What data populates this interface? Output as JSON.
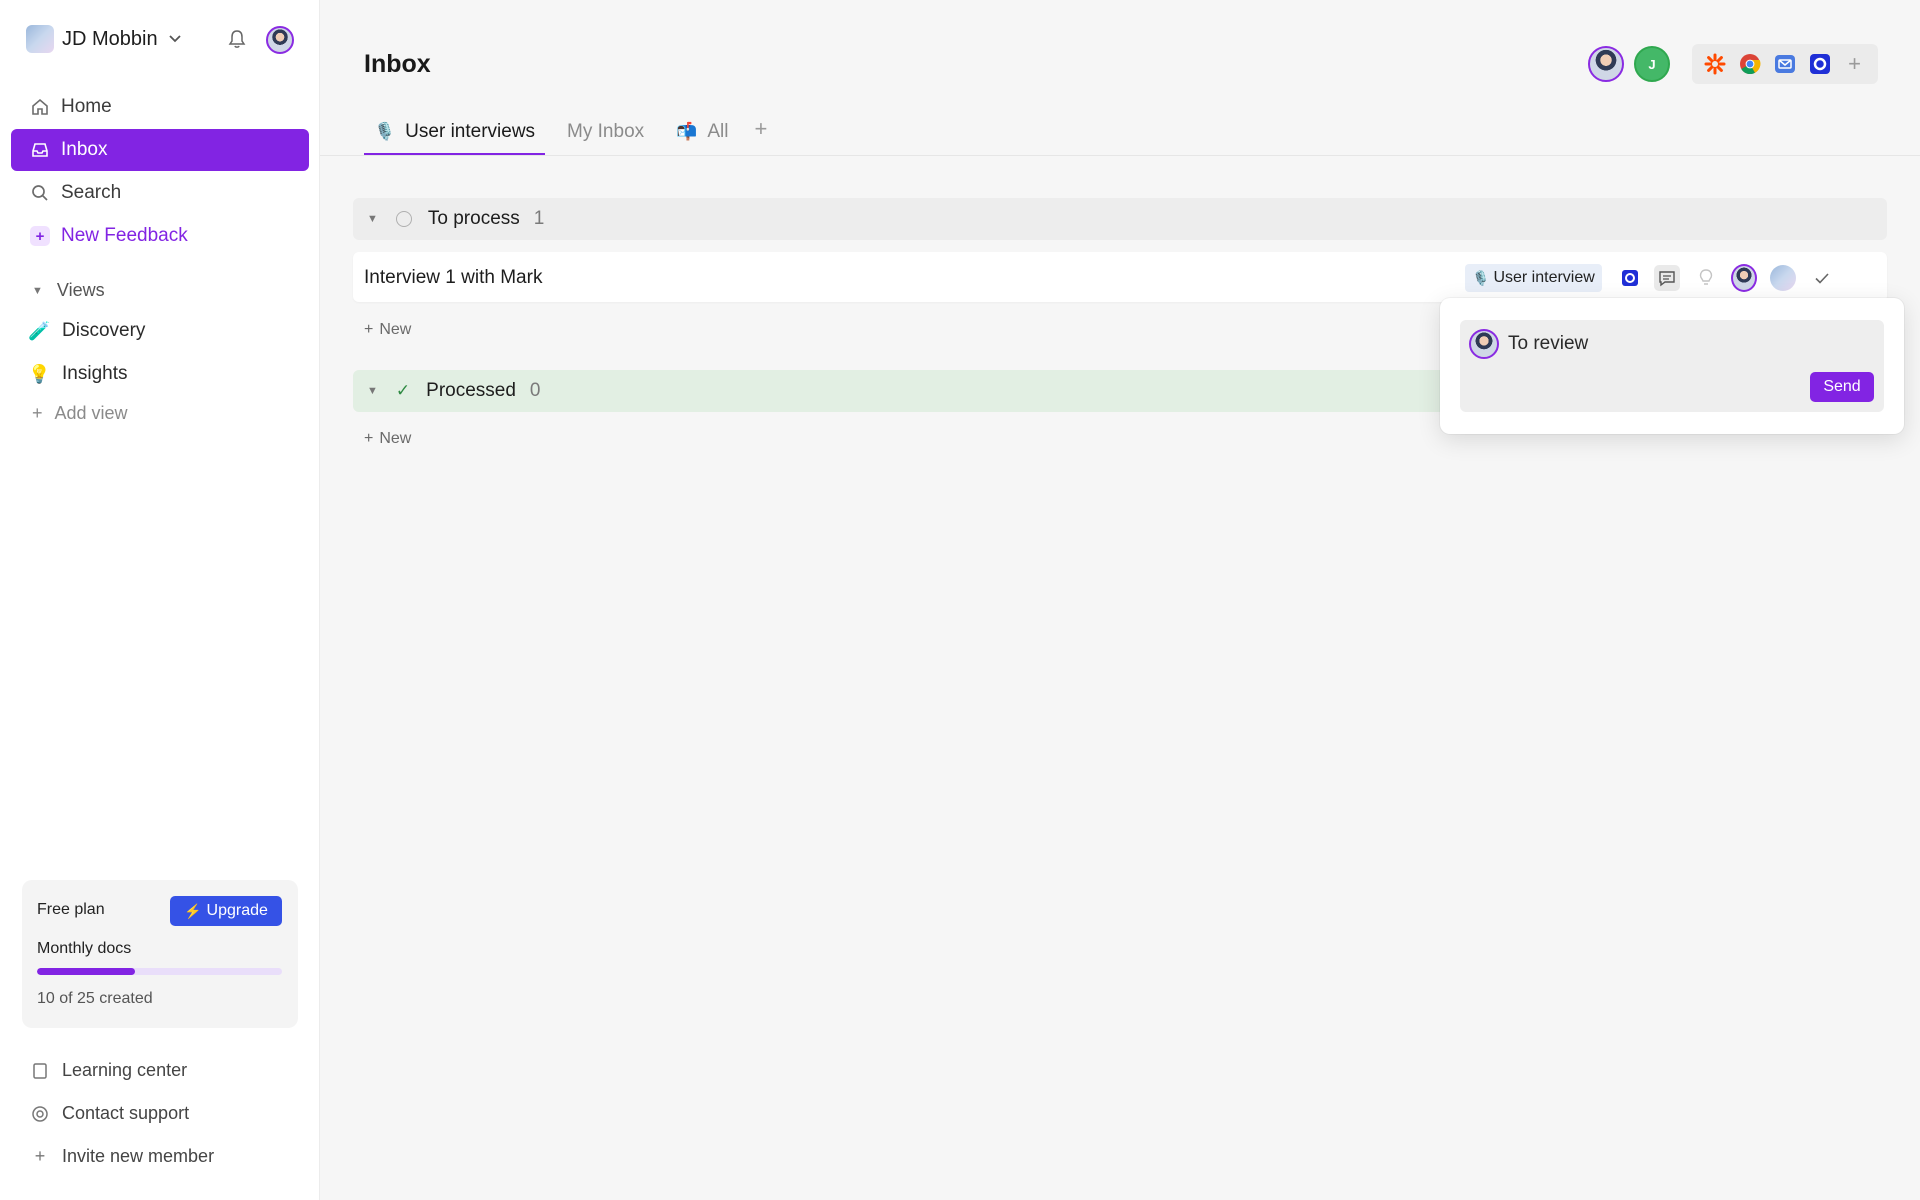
{
  "workspace": {
    "name": "JD Mobbin"
  },
  "sidebar": {
    "nav": [
      {
        "label": "Home",
        "icon": "home-icon"
      },
      {
        "label": "Inbox",
        "icon": "inbox-icon"
      },
      {
        "label": "Search",
        "icon": "search-icon"
      },
      {
        "label": "New Feedback",
        "icon": "plus-icon"
      }
    ],
    "views_heading": "Views",
    "views": [
      {
        "label": "Discovery",
        "emoji": "🧪"
      },
      {
        "label": "Insights",
        "emoji": "💡"
      }
    ],
    "add_view": "Add view",
    "plan": {
      "title": "Free plan",
      "upgrade_label": "Upgrade",
      "meter_label": "Monthly docs",
      "used": 10,
      "limit": 25,
      "created_text": "10 of 25 created"
    },
    "footer": [
      {
        "label": "Learning center",
        "icon": "book-icon"
      },
      {
        "label": "Contact support",
        "icon": "lifebuoy-icon"
      },
      {
        "label": "Invite new member",
        "icon": "plus-icon"
      }
    ]
  },
  "header": {
    "title": "Inbox",
    "collaborators": [
      {
        "initial": ""
      },
      {
        "initial": "J"
      }
    ],
    "integrations": [
      "zapier-icon",
      "chrome-icon",
      "mail-icon",
      "intercom-icon",
      "plus-icon"
    ]
  },
  "tabs": [
    {
      "label": "User interviews",
      "emoji": "🎙️",
      "active": true
    },
    {
      "label": "My Inbox",
      "emoji": "",
      "active": false
    },
    {
      "label": "All",
      "emoji": "📬",
      "active": false
    }
  ],
  "groups": {
    "to_process": {
      "name": "To process",
      "count": "1"
    },
    "processed": {
      "name": "Processed",
      "count": "0"
    }
  },
  "rows": [
    {
      "title": "Interview 1 with Mark",
      "tag": "User interview",
      "tag_emoji": "🎙️"
    }
  ],
  "new_label": "New",
  "popover": {
    "text": "To review",
    "send_label": "Send"
  },
  "colors": {
    "accent": "#8224e3",
    "upgrade": "#3552e6",
    "processed_bg": "#e2efe3"
  }
}
